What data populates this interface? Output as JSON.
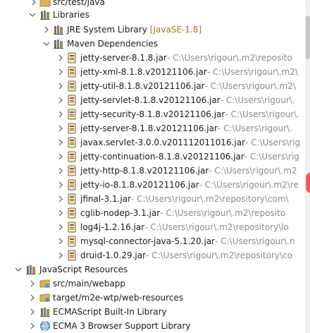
{
  "tree": {
    "src_test_java": {
      "label": "src/test/java"
    },
    "libraries": {
      "label": "Libraries"
    },
    "jre": {
      "label": "JRE System Library",
      "tag": "[JavaSE-1.8]"
    },
    "maven": {
      "label": "Maven Dependencies"
    },
    "jars": [
      {
        "name": "jetty-server-8.1.8.jar",
        "path": " - C:\\Users\\rigour\\.m2\\reposito"
      },
      {
        "name": "jetty-xml-8.1.8.v20121106.jar",
        "path": " - C:\\Users\\rigour\\.m2\\"
      },
      {
        "name": "jetty-util-8.1.8.v20121106.jar",
        "path": " - C:\\Users\\rigour\\.m2\\"
      },
      {
        "name": "jetty-servlet-8.1.8.v20121106.jar",
        "path": " - C:\\Users\\rigour\\."
      },
      {
        "name": "jetty-security-8.1.8.v20121106.jar",
        "path": " - C:\\Users\\rigour\\."
      },
      {
        "name": "jetty-server-8.1.8.v20121106.jar",
        "path": " - C:\\Users\\rigour\\."
      },
      {
        "name": "javax.servlet-3.0.0.v201112011016.jar",
        "path": " - C:\\Users\\rig"
      },
      {
        "name": "jetty-continuation-8.1.8.v20121106.jar",
        "path": " - C:\\Users\\rig"
      },
      {
        "name": "jetty-http-8.1.8.v20121106.jar",
        "path": " - C:\\Users\\rigour\\.m2"
      },
      {
        "name": "jetty-io-8.1.8.v20121106.jar",
        "path": " - C:\\Users\\rigour\\.m2\\re"
      },
      {
        "name": "jfinal-3.1.jar",
        "path": " - C:\\Users\\rigour\\.m2\\repository\\com\\"
      },
      {
        "name": "cglib-nodep-3.1.jar",
        "path": " - C:\\Users\\rigour\\.m2\\reposito"
      },
      {
        "name": "log4j-1.2.16.jar",
        "path": " - C:\\Users\\rigour\\.m2\\repository\\lo"
      },
      {
        "name": "mysql-connector-java-5.1.20.jar",
        "path": " - C:\\Users\\rigour\\.n"
      },
      {
        "name": "druid-1.0.29.jar",
        "path": " - C:\\Users\\rigour\\.m2\\repository\\co"
      }
    ],
    "js_resources": {
      "label": "JavaScript Resources"
    },
    "js_children": [
      {
        "label": "src/main/webapp"
      },
      {
        "label": "target/m2e-wtp/web-resources"
      },
      {
        "label": "ECMAScript Built-In Library"
      },
      {
        "label": "ECMA 3 Browser Support Library"
      }
    ]
  },
  "colors": {
    "decorator": "#8a8a8a",
    "tag": "#a07a2c",
    "jar_icon": "#7a5c2e",
    "folder": "#c8a24a"
  },
  "icons": {
    "expanded": "chevron-down-icon",
    "collapsed": "chevron-right-icon",
    "jar": "jar-icon",
    "library": "library-icon",
    "folder": "folder-icon",
    "js": "js-resources-icon",
    "globe": "globe-icon"
  }
}
